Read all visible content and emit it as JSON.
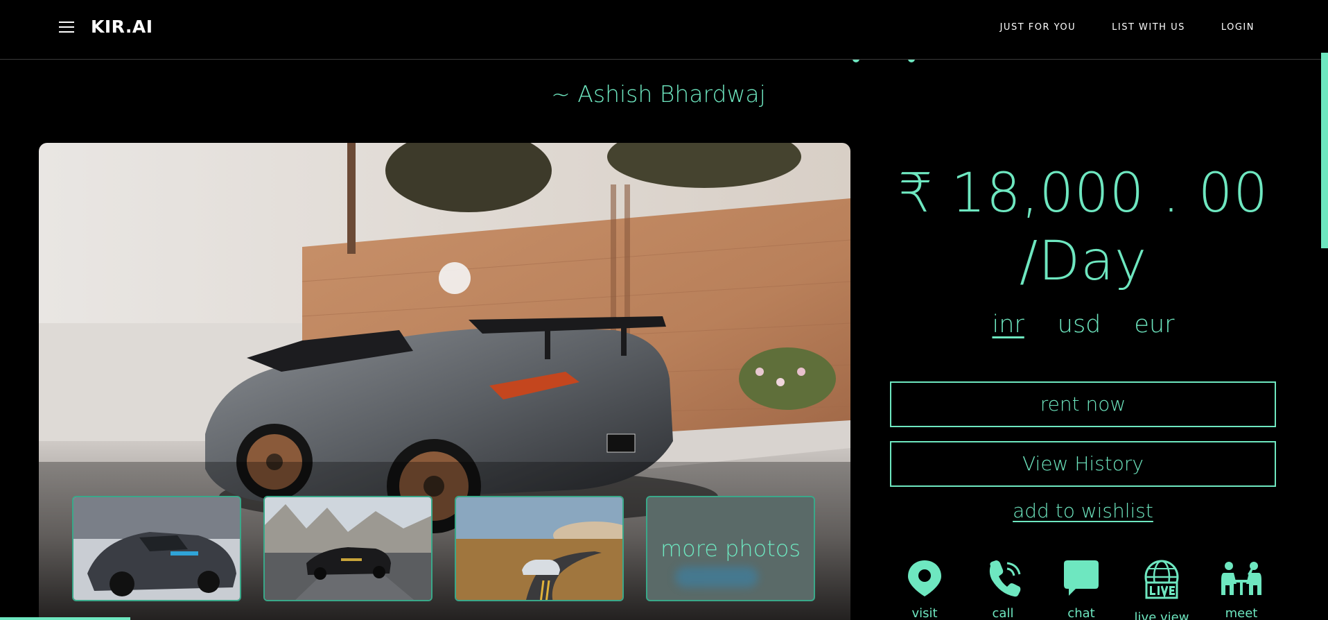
{
  "header": {
    "logo": "KIR.AI",
    "nav": [
      "Just For You",
      "List With Us",
      "Login"
    ]
  },
  "listing": {
    "author": "~ Ashish Bhardwaj",
    "price_line1": "₹ 18,000 . 00",
    "price_line2": "/Day",
    "currencies": [
      "inr",
      "usd",
      "eur"
    ],
    "active_currency": "inr",
    "rent_now_label": "rent now",
    "view_history_label": "View History",
    "wishlist_label": "add to wishlist",
    "more_photos_label": "more photos"
  },
  "actions": [
    {
      "label": "visit",
      "icon": "location-pin-icon"
    },
    {
      "label": "call",
      "icon": "phone-icon"
    },
    {
      "label": "chat",
      "icon": "chat-bubble-icon"
    },
    {
      "label": "live view",
      "icon": "live-globe-icon"
    },
    {
      "label": "meet",
      "icon": "meeting-icon"
    }
  ],
  "colors": {
    "accent": "#6ee7c0",
    "background": "#000000",
    "header_text": "#ffffff"
  }
}
